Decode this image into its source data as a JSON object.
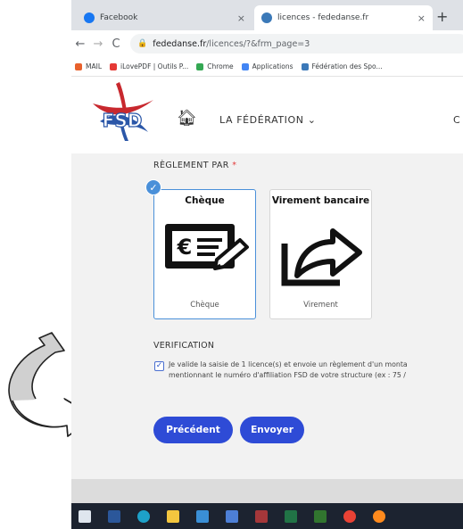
{
  "tabs": [
    {
      "title": "Facebook",
      "close": "×"
    },
    {
      "title": "licences - fededanse.fr",
      "close": "×"
    }
  ],
  "new_tab": "+",
  "nav": {
    "back": "←",
    "forward": "→",
    "reload": "C"
  },
  "address": {
    "host": "fededanse.fr",
    "path": "/licences/?&frm_page=3"
  },
  "bookmarks": [
    {
      "label": "MAIL",
      "color": "#e8612c"
    },
    {
      "label": "iLovePDF | Outils P...",
      "color": "#e53935"
    },
    {
      "label": "Chrome",
      "color": "#34a853"
    },
    {
      "label": "Applications",
      "color": "#4285f4"
    },
    {
      "label": "Fédération des Spo...",
      "color": "#3b79b8"
    }
  ],
  "site": {
    "logo_text": "FSD",
    "nav_federation": "LA FÉDÉRATION ⌄",
    "nav_partial": "C"
  },
  "form": {
    "reglement_label": "RÈGLEMENT PAR",
    "required_mark": "*",
    "cards": [
      {
        "title": "Chèque",
        "caption": "Chèque",
        "selected": true
      },
      {
        "title": "Virement bancaire",
        "caption": "Virement",
        "selected": false
      }
    ],
    "check_badge": "✓",
    "verification_label": "VERIFICATION",
    "verification_checked": true,
    "checkbox_mark": "✓",
    "verification_line1": "Je valide la saisie de 1 licence(s) et envoie un règlement d'un monta",
    "verification_line2": "mentionnant le numéro d'affiliation FSD de votre structure (ex : 75 /",
    "btn_previous": "Précédent",
    "btn_submit": "Envoyer"
  },
  "taskbar_icons": [
    "windows-start",
    "word",
    "edge",
    "file-explorer",
    "mail",
    "store",
    "access",
    "excel",
    "project",
    "chrome",
    "firefox"
  ]
}
